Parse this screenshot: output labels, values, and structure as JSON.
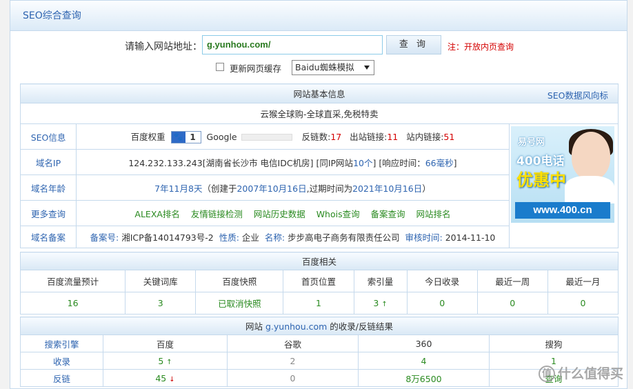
{
  "header": {
    "title": "SEO综合查询"
  },
  "query": {
    "label": "请输入网站地址：",
    "url": "g.yunhou.com/",
    "button": "查 询",
    "note": "注：开放内页查询",
    "refresh_label": "更新网页缓存",
    "mode": "Baidu蜘蛛模拟"
  },
  "basic": {
    "title": "网站基本信息",
    "right_link": "SEO数据风向标",
    "site_title": "云猴全球购-全球直采,免税特卖",
    "seo_label": "SEO信息",
    "bd_weight_label": "百度权重",
    "bd_weight": "1",
    "google_label": "Google",
    "backlinks_label": "反链数:",
    "backlinks": "17",
    "outlinks_label": "出站链接:",
    "outlinks": "11",
    "inlinks_label": "站内链接:",
    "inlinks": "51",
    "ip_label": "域名IP",
    "ip": "124.232.133.243[湖南省长沙市 电信IDC机房]",
    "same_ip_pre": "[同IP网站",
    "same_ip": "10个",
    "same_ip_post": "]",
    "resp_pre": "[响应时间：",
    "resp": "66毫秒",
    "resp_post": "]",
    "age_label": "域名年龄",
    "age": "7年11月8天",
    "age_mid1": "（创建于",
    "created": "2007年10月16日",
    "age_mid2": ",过期时间为",
    "expires": "2021年10月16日",
    "age_end": "）",
    "more_label": "更多查询",
    "more_links": [
      "ALEXA排名",
      "友情链接检测",
      "网站历史数据",
      "Whois查询",
      "备案查询",
      "网站排名"
    ],
    "icp_label": "域名备案",
    "icp_no_label": "备案号:",
    "icp_no": "湘ICP备14014793号-2",
    "nature_label": "性质:",
    "nature": "企业",
    "name_label": "名称:",
    "name": "步步高电子商务有限责任公司",
    "audit_label": "审核时间:",
    "audit": "2014-11-10"
  },
  "ad": {
    "brand": "易号网",
    "phone": "400电话",
    "promo": "优惠中",
    "site": "www.400.cn"
  },
  "baidu": {
    "title": "百度相关",
    "headers": [
      "百度流量预计",
      "关键词库",
      "百度快照",
      "首页位置",
      "索引量",
      "今日收录",
      "最近一周",
      "最近一月"
    ],
    "values": [
      "16",
      "3",
      "已取消快照",
      "1",
      "3",
      "0",
      "0",
      "0"
    ],
    "index_trend": "↑"
  },
  "results": {
    "title_pre": "网站 ",
    "domain": "g.yunhou.com",
    "title_post": " 的收录/反链结果",
    "headers": [
      "搜索引擎",
      "百度",
      "谷歌",
      "360",
      "搜狗"
    ],
    "rows": [
      {
        "label": "收录",
        "cells": [
          "5",
          "2",
          "4",
          "1"
        ],
        "trend": "↑"
      },
      {
        "label": "反链",
        "cells": [
          "45",
          "0",
          "8万6500",
          "查询"
        ],
        "trend": "↓"
      }
    ]
  },
  "colors": {
    "accent": "#2e64b0",
    "red": "#d40000",
    "green": "#2a8a20",
    "border": "#c5d9ec"
  },
  "watermark": "值 什么值得买"
}
